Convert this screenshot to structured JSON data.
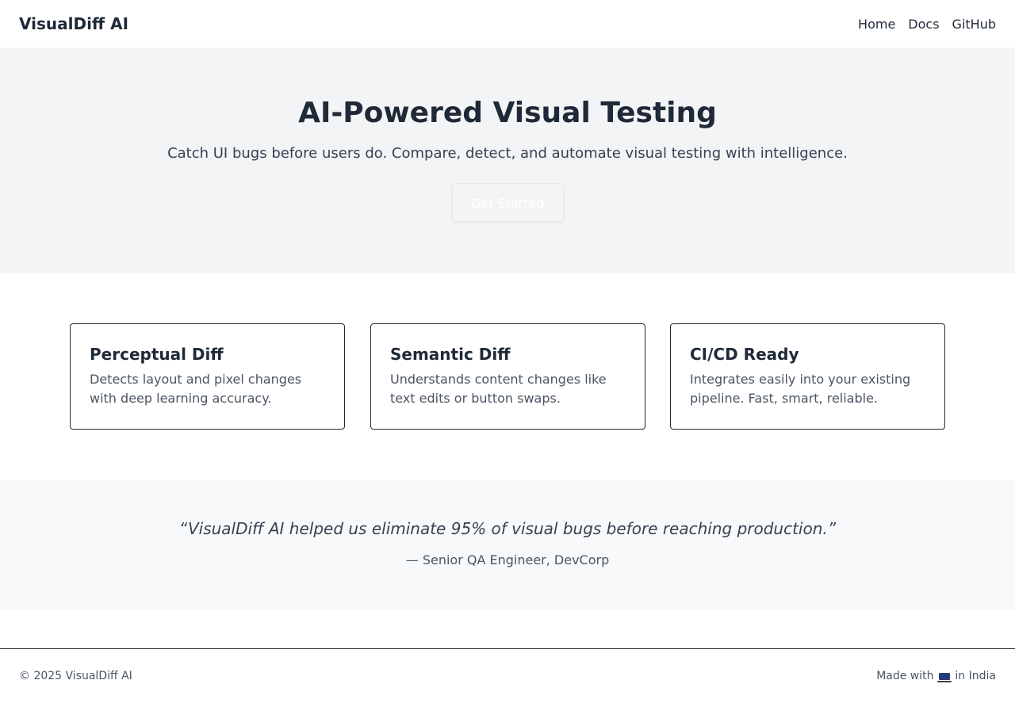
{
  "nav": {
    "brand": "VisualDiff AI",
    "links": [
      "Home",
      "Docs",
      "GitHub"
    ]
  },
  "hero": {
    "title": "AI-Powered Visual Testing",
    "subtitle": "Catch UI bugs before users do. Compare, detect, and automate visual testing with intelligence.",
    "cta_label": "Get Started"
  },
  "features": [
    {
      "title": "Perceptual Diff",
      "description": "Detects layout and pixel changes with deep learning accuracy."
    },
    {
      "title": "Semantic Diff",
      "description": "Understands content changes like text edits or button swaps."
    },
    {
      "title": "CI/CD Ready",
      "description": "Integrates easily into your existing pipeline. Fast, smart, reliable."
    }
  ],
  "testimonial": {
    "quote": "“VisualDiff AI helped us eliminate 95% of visual bugs before reaching production.”",
    "author": "— Senior QA Engineer, DevCorp"
  },
  "footer": {
    "copyright": "© 2025 VisualDiff AI",
    "made_with_prefix": "Made with",
    "made_with_icon": "laptop-icon",
    "made_with_suffix": "in India"
  },
  "colors": {
    "text_dark": "#1f2937",
    "hero_bg": "#f3f4f6",
    "testimonial_bg": "#f8f9fa"
  }
}
